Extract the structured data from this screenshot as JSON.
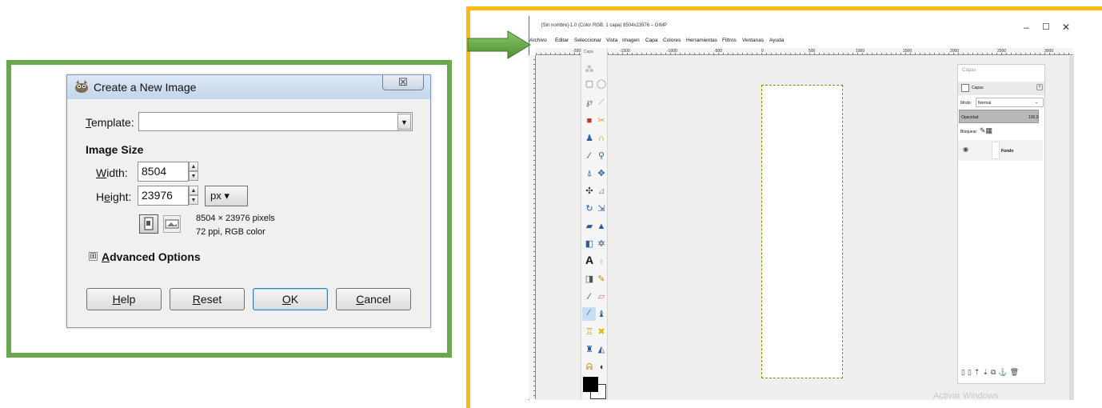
{
  "dialog": {
    "title": "Create a New Image",
    "close_symbol": "☒",
    "template_label": "Template:",
    "template_value": "",
    "image_size_heading": "Image Size",
    "width_label": "Width:",
    "width_value": "8504",
    "height_label": "Height:",
    "height_value": "23976",
    "unit": "px ▾",
    "info_dimensions": "8504 × 23976 pixels",
    "info_resolution": "72 ppi, RGB color",
    "advanced_toggle": "⊞",
    "advanced_label": "Advanced Options",
    "buttons": {
      "help": "Help",
      "reset": "Reset",
      "ok": "OK",
      "cancel": "Cancel"
    }
  },
  "gimp": {
    "title": "[Sin nombre]-1.0 (Color RGB, 1 capa) 8504x23976 – GIMP",
    "window_controls": {
      "minimize": "–",
      "maximize": "☐",
      "close": "✕"
    },
    "menu": [
      "Archivo",
      "Editar",
      "Seleccionar",
      "Vista",
      "Imagen",
      "Capa",
      "Colores",
      "Herramientas",
      "Filtros",
      "Ventanas",
      "Ayuda"
    ],
    "ruler_labels": [
      "-2000",
      "-1500",
      "-1000",
      "-500",
      "0",
      "500",
      "1000",
      "1500",
      "2000",
      "2500",
      "3000"
    ],
    "toolbox_title": "Capa",
    "layers_panel": {
      "title": "Capas",
      "tab_label": "Capas",
      "mode_label": "Modo:",
      "mode_value": "Normal",
      "opacity_label": "Opacidad",
      "opacity_value": "100,0",
      "lock_label": "Bloquear:",
      "layer_name": "Fondo"
    },
    "watermark": "Activar Windows"
  },
  "colors": {
    "left_frame": "#6aa84f",
    "right_frame": "#f6bb14",
    "arrow": "#6aa84f"
  }
}
